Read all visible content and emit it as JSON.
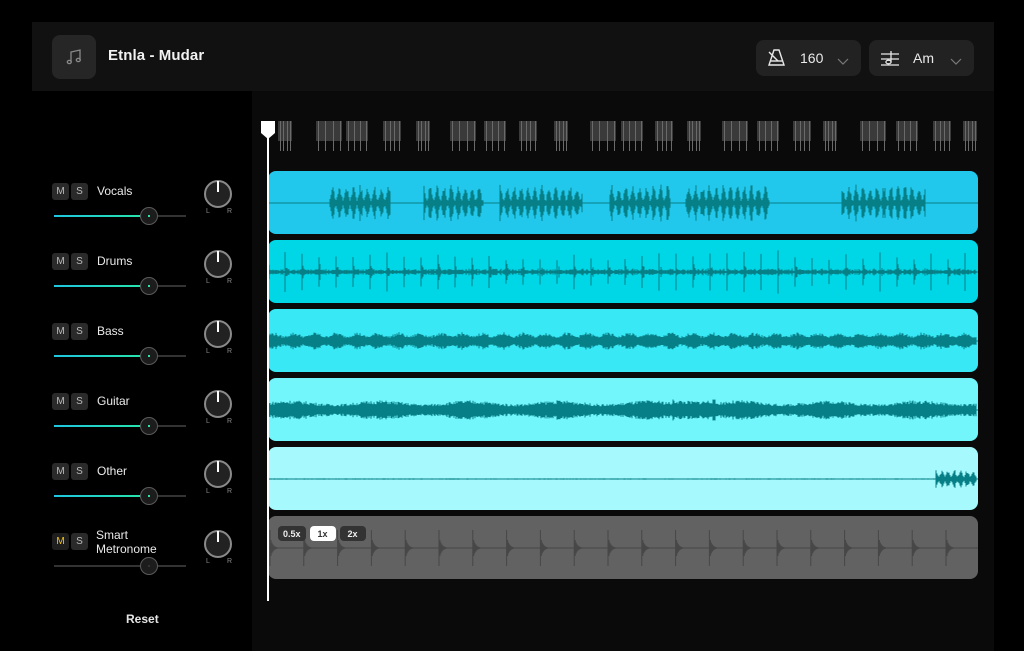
{
  "header": {
    "song_title": "Etnla - Mudar",
    "song_icon": "music-note-icon",
    "tempo": {
      "value": "160",
      "icon": "metronome-icon"
    },
    "key": {
      "value": "Am",
      "icon": "music-staff-icon"
    }
  },
  "tracks": [
    {
      "name": "Vocals",
      "mute_label": "M",
      "solo_label": "S",
      "muted": false,
      "volume": 0.72,
      "pan": 0,
      "pan_left": "L",
      "pan_right": "R",
      "color": "#22c7ec"
    },
    {
      "name": "Drums",
      "mute_label": "M",
      "solo_label": "S",
      "muted": false,
      "volume": 0.72,
      "pan": 0,
      "pan_left": "L",
      "pan_right": "R",
      "color": "#00d7e6"
    },
    {
      "name": "Bass",
      "mute_label": "M",
      "solo_label": "S",
      "muted": false,
      "volume": 0.72,
      "pan": 0,
      "pan_left": "L",
      "pan_right": "R",
      "color": "#38e8f5"
    },
    {
      "name": "Guitar",
      "mute_label": "M",
      "solo_label": "S",
      "muted": false,
      "volume": 0.72,
      "pan": 0,
      "pan_left": "L",
      "pan_right": "R",
      "color": "#72f6fc"
    },
    {
      "name": "Other",
      "mute_label": "M",
      "solo_label": "S",
      "muted": false,
      "volume": 0.72,
      "pan": 0,
      "pan_left": "L",
      "pan_right": "R",
      "color": "#a6fafd"
    },
    {
      "name": "Smart\nMetronome",
      "mute_label": "M",
      "solo_label": "S",
      "muted": true,
      "volume": 0.72,
      "pan": 0,
      "pan_left": "L",
      "pan_right": "R",
      "color": "#626262"
    }
  ],
  "metronome_speeds": [
    {
      "label": "0.5x",
      "active": false
    },
    {
      "label": "1x",
      "active": true
    },
    {
      "label": "2x",
      "active": false
    }
  ],
  "reset_label": "Reset",
  "colors": {
    "waveform": "#067f86",
    "metronome_wave": "#474747",
    "slider_fill_start": "#1fc6e0",
    "slider_fill_end": "#27e6a6",
    "mute_active": "#f5c518"
  },
  "playhead_position": 0
}
